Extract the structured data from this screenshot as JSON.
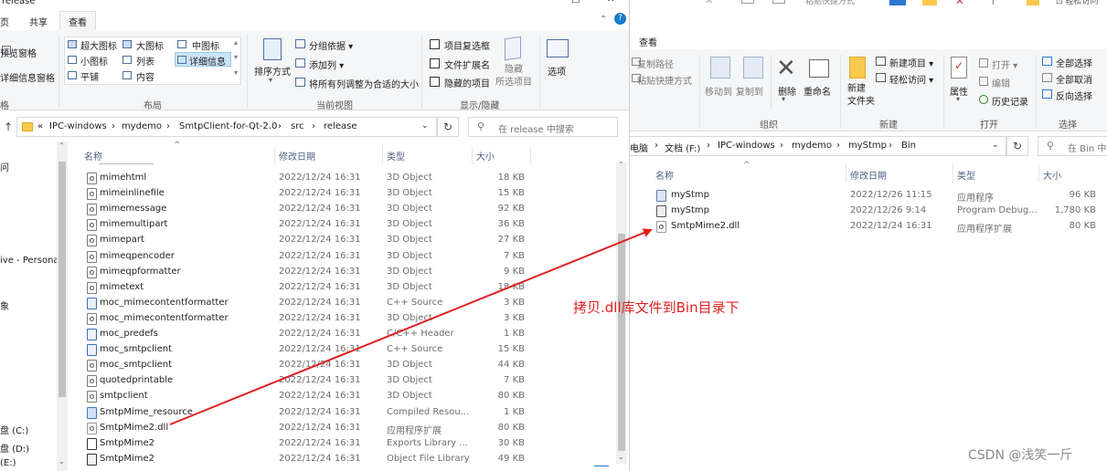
{
  "colors": {
    "accent": "#1979ca",
    "annotation": "#e02020",
    "folder": "#f8c94c"
  },
  "left": {
    "title_fragment": "release",
    "tabs": [
      "页",
      "共享",
      "查看"
    ],
    "active_tab": "查看",
    "ribbon": {
      "pane_items": [
        "预览窗格",
        "详细信息窗格"
      ],
      "pane_group": "格",
      "layout_items": [
        "超大图标",
        "大图标",
        "中图标",
        "小图标",
        "列表",
        "详细信息",
        "平铺",
        "内容"
      ],
      "layout_group": "布局",
      "sort_label": "排序方式",
      "group_by": "分组依据 ▾",
      "add_column": "添加列 ▾",
      "fit_columns": "将所有列调整为合适的大小",
      "view_group": "当前视图",
      "checkboxes": [
        "项目复选框",
        "文件扩展名",
        "隐藏的项目"
      ],
      "hide_selected": "隐藏\n所选项目",
      "show_group": "显示/隐藏",
      "options": "选项"
    },
    "breadcrumb": [
      "«",
      "IPC-windows",
      "mydemo",
      "SmtpClient-for-Qt-2.0",
      "src",
      "release"
    ],
    "search_placeholder": "在 release 中搜索",
    "columns": [
      "名称",
      "修改日期",
      "类型",
      "大小"
    ],
    "nav_items": [
      "问",
      "ive - Persona",
      "象",
      "盘 (C:)",
      "盘 (D:)",
      "(E:)"
    ],
    "files": [
      {
        "name": "mimehtml",
        "date": "2022/12/24 16:31",
        "type": "3D Object",
        "size": "18 KB",
        "icon": "obj"
      },
      {
        "name": "mimeinlinefile",
        "date": "2022/12/24 16:31",
        "type": "3D Object",
        "size": "15 KB",
        "icon": "obj"
      },
      {
        "name": "mimemessage",
        "date": "2022/12/24 16:31",
        "type": "3D Object",
        "size": "92 KB",
        "icon": "obj"
      },
      {
        "name": "mimemultipart",
        "date": "2022/12/24 16:31",
        "type": "3D Object",
        "size": "36 KB",
        "icon": "obj"
      },
      {
        "name": "mimepart",
        "date": "2022/12/24 16:31",
        "type": "3D Object",
        "size": "27 KB",
        "icon": "obj"
      },
      {
        "name": "mimeqpencoder",
        "date": "2022/12/24 16:31",
        "type": "3D Object",
        "size": "7 KB",
        "icon": "obj"
      },
      {
        "name": "mimeqpformatter",
        "date": "2022/12/24 16:31",
        "type": "3D Object",
        "size": "9 KB",
        "icon": "obj"
      },
      {
        "name": "mimetext",
        "date": "2022/12/24 16:31",
        "type": "3D Object",
        "size": "18 KB",
        "icon": "obj"
      },
      {
        "name": "moc_mimecontentformatter",
        "date": "2022/12/24 16:31",
        "type": "C++ Source",
        "size": "3 KB",
        "icon": "cpp"
      },
      {
        "name": "moc_mimecontentformatter",
        "date": "2022/12/24 16:31",
        "type": "3D Object",
        "size": "3 KB",
        "icon": "obj"
      },
      {
        "name": "moc_predefs",
        "date": "2022/12/24 16:31",
        "type": "C/C++ Header",
        "size": "1 KB",
        "icon": "h"
      },
      {
        "name": "moc_smtpclient",
        "date": "2022/12/24 16:31",
        "type": "C++ Source",
        "size": "15 KB",
        "icon": "cpp"
      },
      {
        "name": "moc_smtpclient",
        "date": "2022/12/24 16:31",
        "type": "3D Object",
        "size": "44 KB",
        "icon": "obj"
      },
      {
        "name": "quotedprintable",
        "date": "2022/12/24 16:31",
        "type": "3D Object",
        "size": "7 KB",
        "icon": "obj"
      },
      {
        "name": "smtpclient",
        "date": "2022/12/24 16:31",
        "type": "3D Object",
        "size": "80 KB",
        "icon": "obj"
      },
      {
        "name": "SmtpMime_resource",
        "date": "2022/12/24 16:31",
        "type": "Compiled Resou...",
        "size": "1 KB",
        "icon": "res"
      },
      {
        "name": "SmtpMime2.dll",
        "date": "2022/12/24 16:31",
        "type": "应用程序扩展",
        "size": "80 KB",
        "icon": "dll"
      },
      {
        "name": "SmtpMime2",
        "date": "2022/12/24 16:31",
        "type": "Exports Library ...",
        "size": "30 KB",
        "icon": "exp"
      },
      {
        "name": "SmtpMime2",
        "date": "2022/12/24 16:31",
        "type": "Object File Library",
        "size": "49 KB",
        "icon": "lib"
      }
    ]
  },
  "right": {
    "tab": "查看",
    "ribbon": {
      "copy_path": "复制路径",
      "paste_shortcut": "粘贴快捷方式",
      "move_to": "移动到",
      "copy_to": "复制到",
      "delete": "删除",
      "rename": "重命名",
      "organize_group": "组织",
      "new_folder": "新建\n文件夹",
      "new_item": "新建项目 ▾",
      "easy_access": "轻松访问 ▾",
      "new_group": "新建",
      "properties": "属性",
      "open": "打开 ▾",
      "edit": "编辑",
      "history": "历史记录",
      "open_group": "打开",
      "select_all": "全部选择",
      "select_none": "全部取消",
      "invert": "反向选择",
      "select_group": "选择"
    },
    "breadcrumb": [
      "电脑",
      "文档 (F:)",
      "IPC-windows",
      "mydemo",
      "myStmp",
      "Bin"
    ],
    "search_placeholder": "在 Bin 中",
    "columns": [
      "名称",
      "修改日期",
      "类型",
      "大小"
    ],
    "files": [
      {
        "name": "myStmp",
        "date": "2022/12/26 11:15",
        "type": "应用程序",
        "size": "96 KB",
        "icon": "exe"
      },
      {
        "name": "myStmp",
        "date": "2022/12/26 9:14",
        "type": "Program Debug...",
        "size": "1,780 KB",
        "icon": "pdb"
      },
      {
        "name": "SmtpMime2.dll",
        "date": "2022/12/24 16:31",
        "type": "应用程序扩展",
        "size": "80 KB",
        "icon": "dll"
      }
    ]
  },
  "annotation": "拷贝.dll库文件到Bin目录下",
  "watermark": "CSDN @浅笑一斤"
}
